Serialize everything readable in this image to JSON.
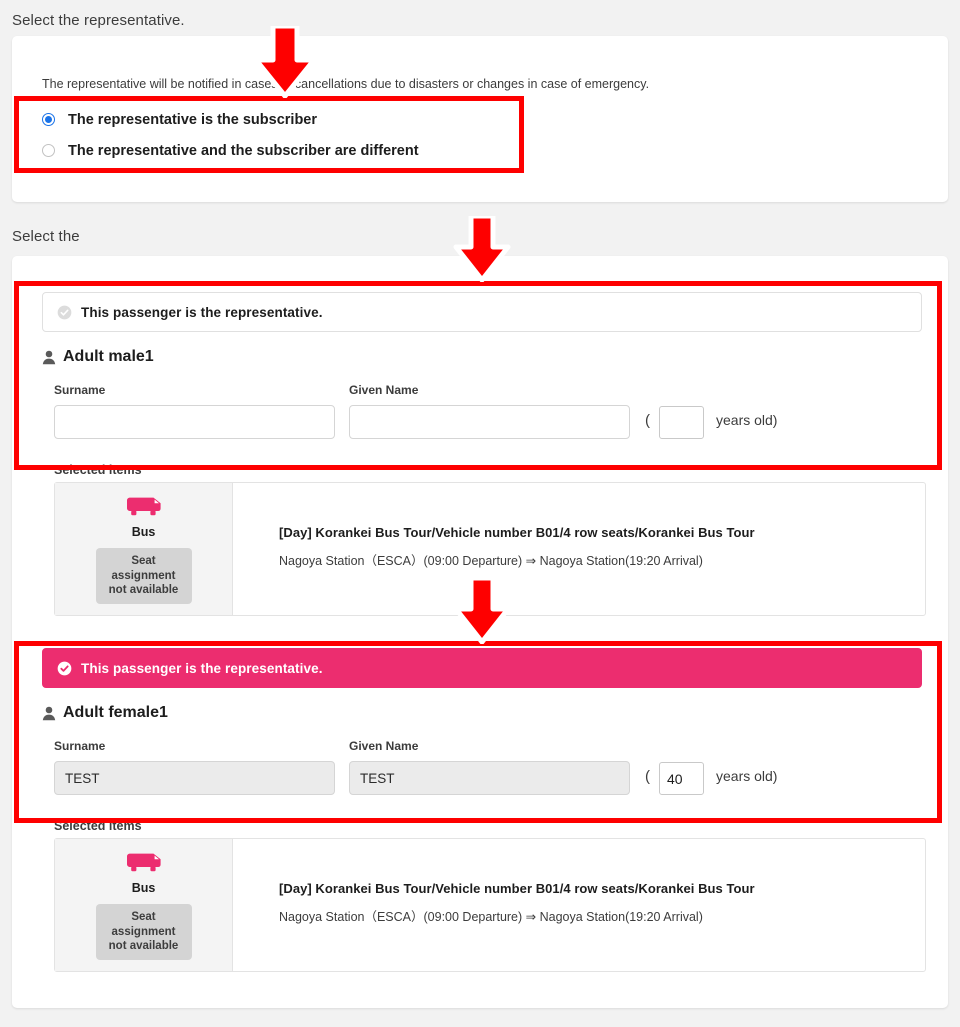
{
  "page": {
    "background_color": "#f2f2f2",
    "accent_pink": "#ec2d6f",
    "radio_blue": "#1a73e8",
    "annotation_red": "#fe0000"
  },
  "sections": {
    "representative": {
      "heading": "Select the representative.",
      "notice": "The representative will be notified in cases of cancellations due to disasters or changes in case of emergency.",
      "options": [
        {
          "label": "The representative is the subscriber",
          "selected": true
        },
        {
          "label": "The representative and the subscriber are different",
          "selected": false
        }
      ]
    },
    "passengers": {
      "heading": "Select the",
      "selected_items_label": "Selected items",
      "list": [
        {
          "rep_banner_text": "This passenger is the representative.",
          "rep_banner_active": false,
          "name": "Adult male1",
          "surname_label": "Surname",
          "given_name_label": "Given Name",
          "surname_value": "",
          "given_name_value": "",
          "age_value": "",
          "paren_open": "(",
          "years_old": "years old)",
          "item": {
            "mode_label": "Bus",
            "seat_button_label": "Seat\nassignment\nnot available",
            "seat_button_line1": "Seat",
            "seat_button_line2": "assignment",
            "seat_button_line3": "not available",
            "title": "[Day] Korankei Bus Tour/Vehicle number B01/4 row seats/Korankei Bus Tour",
            "route": "Nagoya Station（ESCA）(09:00 Departure) ⇒ Nagoya Station(19:20 Arrival)"
          }
        },
        {
          "rep_banner_text": "This passenger is the representative.",
          "rep_banner_active": true,
          "name": "Adult female1",
          "surname_label": "Surname",
          "given_name_label": "Given Name",
          "surname_value": "TEST",
          "given_name_value": "TEST",
          "age_value": "40",
          "paren_open": "(",
          "years_old": "years old)",
          "item": {
            "mode_label": "Bus",
            "seat_button_line1": "Seat",
            "seat_button_line2": "assignment",
            "seat_button_line3": "not available",
            "title": "[Day] Korankei Bus Tour/Vehicle number B01/4 row seats/Korankei Bus Tour",
            "route": "Nagoya Station（ESCA）(09:00 Departure) ⇒ Nagoya Station(19:20 Arrival)"
          }
        }
      ]
    }
  },
  "annotations": {
    "boxes": [
      {
        "name": "radio-options-highlight"
      },
      {
        "name": "passenger-1-highlight"
      },
      {
        "name": "passenger-2-highlight"
      }
    ],
    "arrows": [
      {
        "name": "arrow-to-radio-options"
      },
      {
        "name": "arrow-to-passenger-1"
      },
      {
        "name": "arrow-to-passenger-2"
      }
    ]
  }
}
